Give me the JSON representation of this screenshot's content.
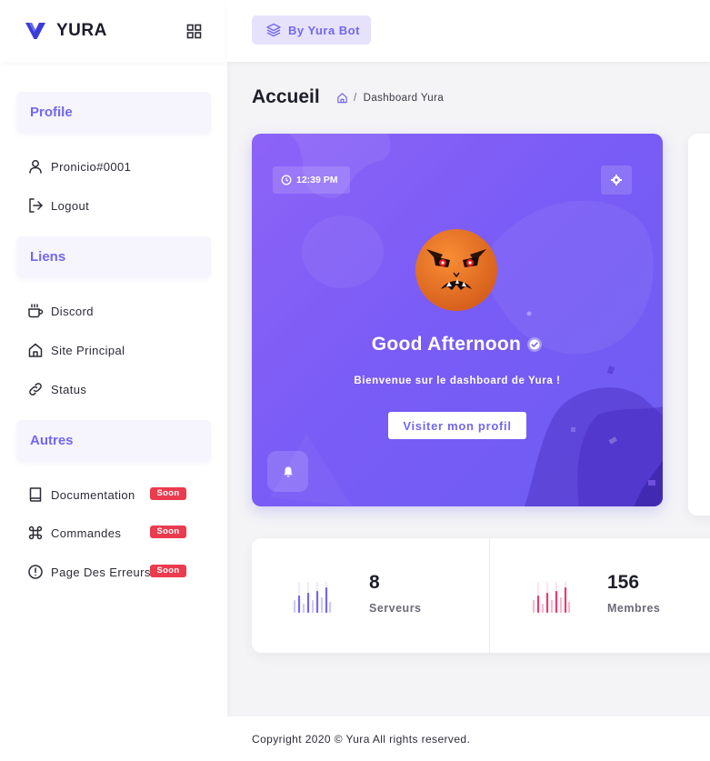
{
  "brand": {
    "name": "YURA",
    "logo_icon": "yura-logo-icon",
    "grid_icon": "grid-icon",
    "color": "#3b3bdc"
  },
  "sidebar": {
    "sections": [
      {
        "title": "Profile",
        "items": [
          {
            "label": "Pronicio#0001",
            "icon": "user-icon"
          },
          {
            "label": "Logout",
            "icon": "logout-icon"
          }
        ]
      },
      {
        "title": "Liens",
        "items": [
          {
            "label": "Discord",
            "icon": "coffee-cup-icon"
          },
          {
            "label": "Site Principal",
            "icon": "home-icon"
          },
          {
            "label": "Status",
            "icon": "link-icon"
          }
        ]
      },
      {
        "title": "Autres",
        "items": [
          {
            "label": "Documentation",
            "icon": "book-icon",
            "badge": "Soon"
          },
          {
            "label": "Commandes",
            "icon": "command-icon",
            "badge": "Soon"
          },
          {
            "label": "Page Des Erreurs",
            "icon": "alert-circle-icon",
            "badge": "Soon"
          }
        ]
      }
    ]
  },
  "topbar": {
    "bot_button": "By Yura Bot",
    "bot_icon": "layers-icon"
  },
  "header": {
    "title": "Accueil",
    "breadcrumb_sep": "/",
    "breadcrumb_current": "Dashboard Yura"
  },
  "hero": {
    "time": "12:39 PM",
    "greeting": "Good Afternoon",
    "welcome": "Bienvenue sur le dashboard de Yura !",
    "profile_button": "Visiter mon profil",
    "accent": "#7367f0"
  },
  "stats": [
    {
      "value": "8",
      "label": "Serveurs",
      "color": "#7367f0"
    },
    {
      "value": "156",
      "label": "Membres",
      "color": "#ea3b70"
    }
  ],
  "footer": {
    "text": "Copyright 2020 © Yura All rights reserved."
  }
}
